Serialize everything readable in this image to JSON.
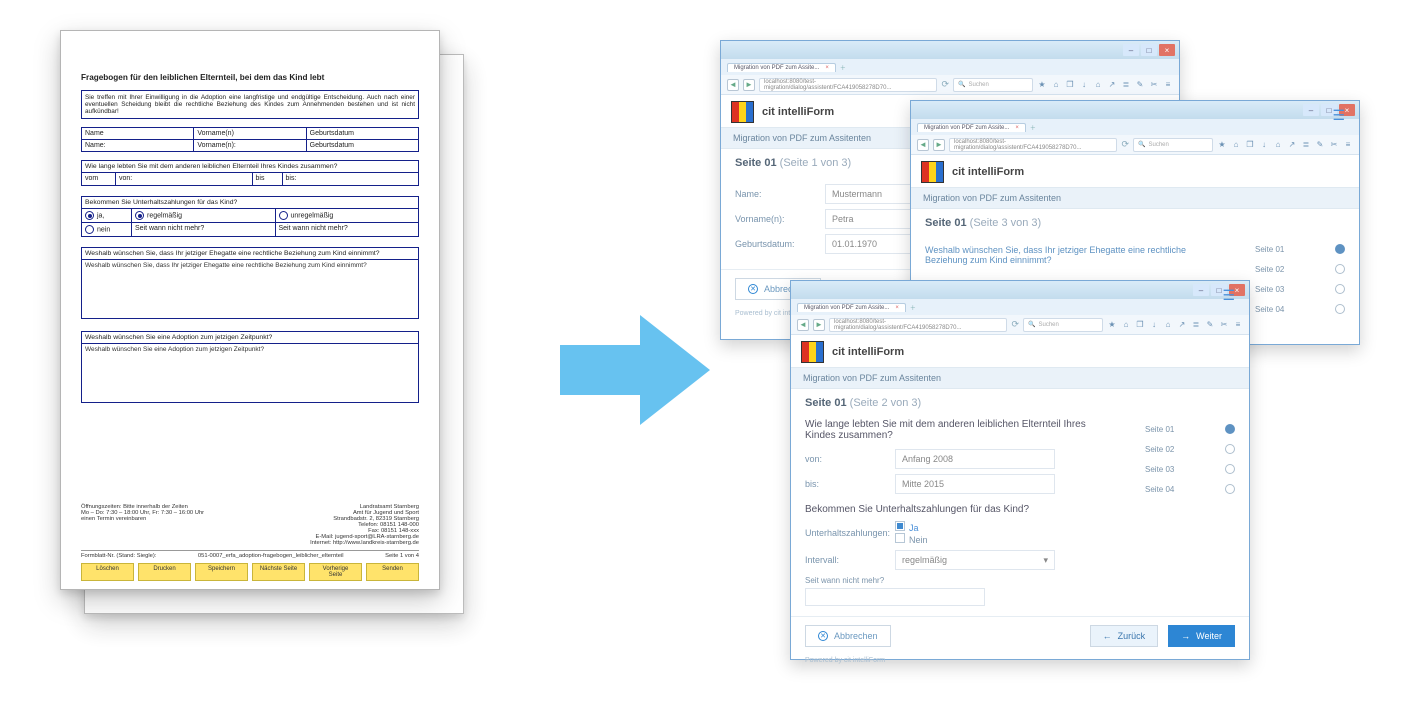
{
  "pdf": {
    "title": "Fragebogen für den leiblichen Elternteil, bei dem das Kind lebt",
    "intro": "Sie treffen mit Ihrer Einwilligung in die Adoption eine langfristige und endgültige Entscheidung. Auch nach einer eventuellen Scheidung bleibt die rechtliche Beziehung des Kindes zum Annehmenden bestehen und ist nicht aufkündbar!",
    "table1_headers": [
      "Name",
      "Vorname(n)",
      "Geburtsdatum"
    ],
    "table1_row2": [
      "Name:",
      "Vorname(n):",
      "Geburtsdatum"
    ],
    "q_duration": "Wie lange lebten Sie mit dem anderen leiblichen Elternteil Ihres Kindes zusammen?",
    "duration_labels": [
      "vom",
      "von:",
      "bis",
      "bis:"
    ],
    "q_pay": "Bekommen Sie Unterhaltszahlungen für das Kind?",
    "pay_opts": [
      "ja,",
      "regelmäßig",
      "unregelmäßig"
    ],
    "pay_opts2": [
      "nein",
      "Seit wann nicht mehr?",
      "Seit wann nicht mehr?"
    ],
    "q_why1_hdr": "Weshalb wünschen Sie, dass Ihr jetziger Ehegatte eine rechtliche Beziehung zum Kind einnimmt?",
    "q_why1_sub": "Weshalb wünschen Sie, dass Ihr jetziger Ehegatte eine rechtliche Beziehung zum Kind einnimmt?",
    "q_why2_hdr": "Weshalb wünschen Sie eine Adoption zum jetzigen Zeitpunkt?",
    "q_why2_sub": "Weshalb wünschen Sie eine Adoption zum jetzigen Zeitpunkt?",
    "footer_left": [
      "Öffnungszeiten: Bitte innerhalb der Zeiten",
      "Mo – Do: 7:30 – 18:00 Uhr, Fr: 7:30 – 16:00 Uhr",
      "einen Termin vereinbaren"
    ],
    "footer_right": [
      "Landratsamt Starnberg",
      "Amt für Jugend und Sport",
      "Strandbadstr. 2, 82319 Starnberg",
      "Telefon: 08151 148-000",
      "Fax: 08151 148-xxx",
      "E-Mail: jugend-sport@LRA-starnberg.de",
      "Internet: http://www.landkreis-starnberg.de"
    ],
    "footer_meta_left": "Formblatt-Nr. (Stand: Siegle):",
    "footer_meta_mid": "051-0007_erfa_adoption-fragebogen_leiblicher_elternteil",
    "footer_meta_right": "Seite 1 von 4",
    "buttons": [
      "Löschen",
      "Drucken",
      "Speichern",
      "Nächste Seite",
      "Vorherige Seite",
      "Senden"
    ]
  },
  "browser": {
    "tab_title": "Migration von PDF zum Assite...",
    "url": "localhost:8080/test-migration/dialog/assistent/FCA419058278D70...",
    "search_placeholder": "Suchen",
    "app_name": "cit intelliForm",
    "breadcrumb": "Migration von PDF zum Assitenten",
    "powered": "Powered by cit intelliForm"
  },
  "win1": {
    "page_title_a": "Seite 01",
    "page_title_b": "(Seite 1 von 3)",
    "fields": {
      "name_label": "Name:",
      "name_val": "Mustermann",
      "vorname_label": "Vorname(n):",
      "vorname_val": "Petra",
      "geb_label": "Geburtsdatum:",
      "geb_val": "01.01.1970"
    },
    "cancel": "Abbrechen"
  },
  "win3": {
    "page_title_a": "Seite 01",
    "page_title_b": "(Seite 3 von 3)",
    "question": "Weshalb wünschen Sie, dass Ihr jetziger Ehegatte eine rechtliche Beziehung zum Kind einnimmt?",
    "nav_items": [
      "Seite 01",
      "Seite 02",
      "Seite 03",
      "Seite 04"
    ]
  },
  "win2": {
    "page_title_a": "Seite 01",
    "page_title_b": "(Seite 2 von 3)",
    "q1": "Wie lange lebten Sie mit dem anderen leiblichen Elternteil Ihres Kindes zusammen?",
    "von_label": "von:",
    "von_val": "Anfang 2008",
    "bis_label": "bis:",
    "bis_val": "Mitte 2015",
    "q2": "Bekommen Sie Unterhaltszahlungen für das Kind?",
    "pay_label": "Unterhaltszahlungen:",
    "pay_ja": "Ja",
    "pay_nein": "Nein",
    "interval_label": "Intervall:",
    "interval_val": "regelmäßig",
    "seit_label": "Seit wann nicht mehr?",
    "cancel": "Abbrechen",
    "back": "Zurück",
    "next": "Weiter",
    "nav_items": [
      "Seite 01",
      "Seite 02",
      "Seite 03",
      "Seite 04"
    ]
  }
}
